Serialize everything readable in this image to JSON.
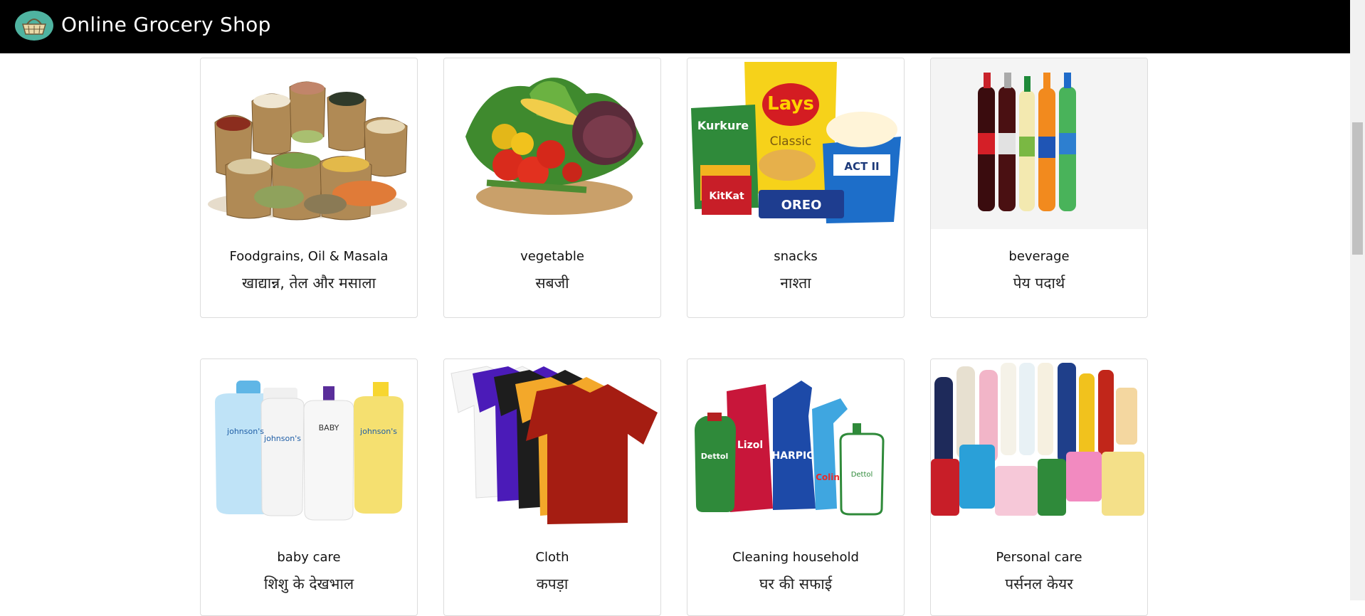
{
  "header": {
    "title": "Online Grocery Shop",
    "logo_icon": "basket-icon",
    "background": "#000000"
  },
  "categories": [
    {
      "title": "Foodgrains, Oil & Masala",
      "subtitle": "खाद्यान्न, तेल और मसाला",
      "image": "grains-sacks-image"
    },
    {
      "title": "vegetable",
      "subtitle": "सबजी",
      "image": "vegetables-image"
    },
    {
      "title": "snacks",
      "subtitle": "नाश्ता",
      "image": "snacks-image"
    },
    {
      "title": "beverage",
      "subtitle": "पेय पदार्थ",
      "image": "soft-drinks-image"
    },
    {
      "title": "baby care",
      "subtitle": "शिशु के देखभाल",
      "image": "baby-products-image"
    },
    {
      "title": "Cloth",
      "subtitle": "कपड़ा",
      "image": "tshirts-image"
    },
    {
      "title": "Cleaning household",
      "subtitle": "घर की सफाई",
      "image": "cleaning-products-image"
    },
    {
      "title": "Personal care",
      "subtitle": "पर्सनल केयर",
      "image": "personal-care-products-image"
    }
  ]
}
